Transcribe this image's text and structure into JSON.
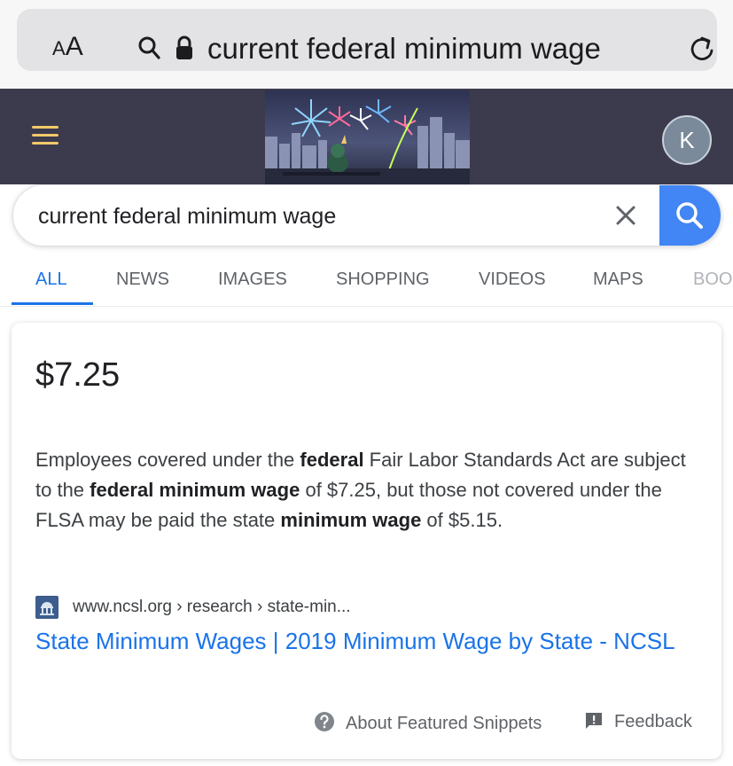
{
  "browser": {
    "text_size_label_small": "A",
    "text_size_label_large": "A",
    "url": "current federal minimum wage"
  },
  "header": {
    "avatar_initial": "K"
  },
  "search": {
    "query": "current federal minimum wage"
  },
  "tabs": [
    {
      "label": "ALL",
      "active": true
    },
    {
      "label": "NEWS"
    },
    {
      "label": "IMAGES"
    },
    {
      "label": "SHOPPING"
    },
    {
      "label": "VIDEOS"
    },
    {
      "label": "MAPS"
    },
    {
      "label": "BOO"
    }
  ],
  "featured_snippet": {
    "answer": "$7.25",
    "snippet": {
      "t1": "Employees covered under the ",
      "b1": "federal",
      "t2": " Fair Labor Standards Act are subject to the ",
      "b2": "federal minimum wage",
      "t3": " of $7.25, but those not covered under the FLSA may be paid the state ",
      "b3": "minimum wage",
      "t4": " of $5.15."
    },
    "cite": "www.ncsl.org › research › state-min...",
    "title": "State Minimum Wages | 2019 Minimum Wage by State - NCSL",
    "about_label": "About Featured Snippets",
    "feedback_label": "Feedback"
  },
  "colors": {
    "header_bg": "#3c3b4e",
    "accent_blue": "#1a73e8",
    "search_button": "#4285f4",
    "hamburger": "#f3c969"
  }
}
